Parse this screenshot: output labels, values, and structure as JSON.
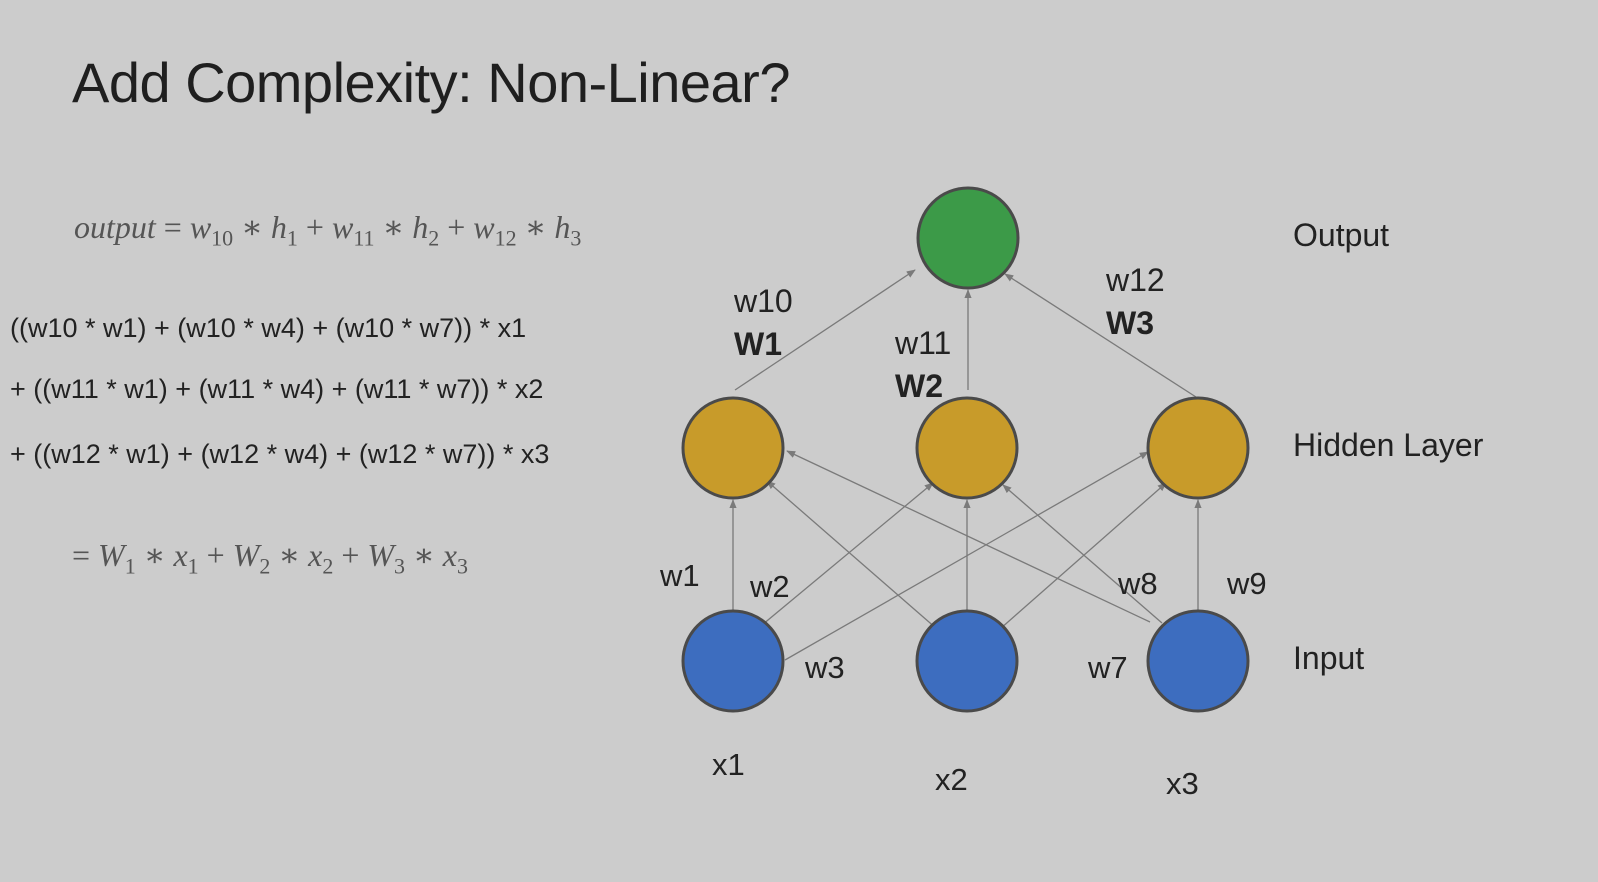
{
  "title": "Add Complexity: Non-Linear?",
  "equation_output": {
    "lhs": "output",
    "terms": [
      {
        "w": "w",
        "wsub": "10",
        "h": "h",
        "hsub": "1"
      },
      {
        "w": "w",
        "wsub": "11",
        "h": "h",
        "hsub": "2"
      },
      {
        "w": "w",
        "wsub": "12",
        "h": "h",
        "hsub": "3"
      }
    ]
  },
  "expansion": [
    "((w10 * w1) + (w10 * w4) + (w10 * w7)) * x1",
    "+ ((w11 * w1) + (w11 * w4) + (w11 * w7)) * x2",
    "+ ((w12 * w1) + (w12 * w4) + (w12 * w7)) * x3"
  ],
  "equation_result": {
    "terms": [
      {
        "W": "W",
        "Wsub": "1",
        "x": "x",
        "xsub": "1"
      },
      {
        "W": "W",
        "Wsub": "2",
        "x": "x",
        "xsub": "2"
      },
      {
        "W": "W",
        "Wsub": "3",
        "x": "x",
        "xsub": "3"
      }
    ]
  },
  "layers": {
    "output": "Output",
    "hidden": "Hidden Layer",
    "input": "Input"
  },
  "inputs": [
    "x1",
    "x2",
    "x3"
  ],
  "top_weights": [
    {
      "w": "w10",
      "W": "W1"
    },
    {
      "w": "w11",
      "W": "W2"
    },
    {
      "w": "w12",
      "W": "W3"
    }
  ],
  "edge_weights": [
    "w1",
    "w2",
    "w3",
    "w7",
    "w8",
    "w9"
  ],
  "colors": {
    "background": "#cccccc",
    "output_node": "#3c9a48",
    "hidden_node": "#c89b2a",
    "input_node": "#3d6dbf",
    "node_stroke": "#4a4a4a",
    "edge": "#7a7a7a"
  }
}
